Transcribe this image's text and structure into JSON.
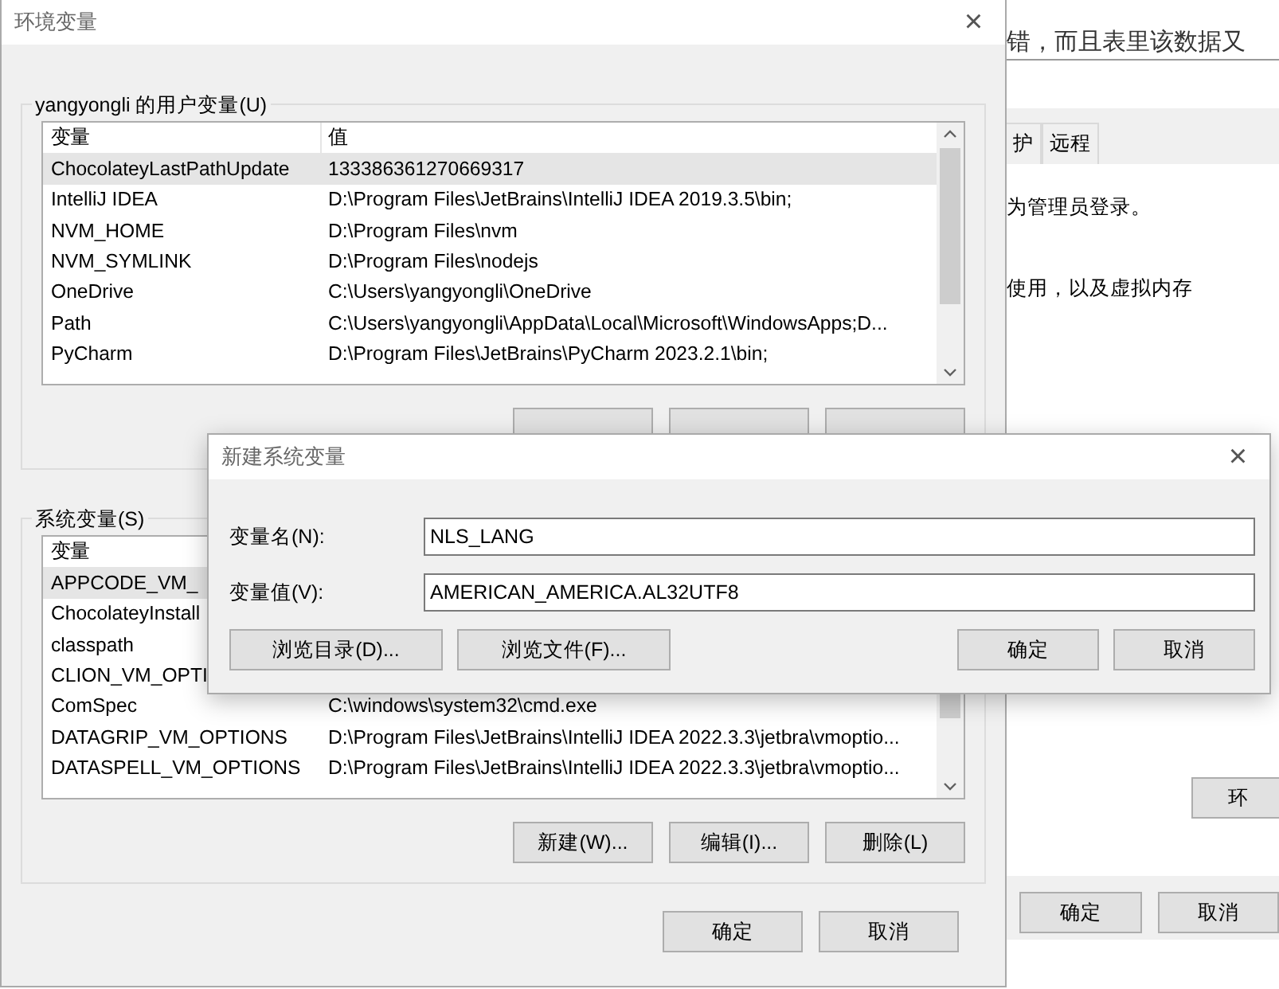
{
  "background_page": {
    "text": "错，而且表里该数据又"
  },
  "system_properties": {
    "tabs": [
      {
        "label": "护",
        "selected": false
      },
      {
        "label": "远程",
        "selected": false
      }
    ],
    "texts": [
      "为管理员登录。",
      "使用，以及虚拟内存"
    ],
    "env_button": "环",
    "buttons": [
      "确定",
      "取消"
    ]
  },
  "env_window": {
    "title": "环境变量",
    "close": "×",
    "user_group": {
      "label": "yangyongli 的用户变量(U)",
      "columns": [
        "变量",
        "值"
      ],
      "rows": [
        {
          "name": "ChocolateyLastPathUpdate",
          "value": "133386361270669317",
          "selected": true
        },
        {
          "name": "IntelliJ IDEA",
          "value": "D:\\Program Files\\JetBrains\\IntelliJ IDEA 2019.3.5\\bin;",
          "selected": false
        },
        {
          "name": "NVM_HOME",
          "value": "D:\\Program Files\\nvm",
          "selected": false
        },
        {
          "name": "NVM_SYMLINK",
          "value": "D:\\Program Files\\nodejs",
          "selected": false
        },
        {
          "name": "OneDrive",
          "value": "C:\\Users\\yangyongli\\OneDrive",
          "selected": false
        },
        {
          "name": "Path",
          "value": "C:\\Users\\yangyongli\\AppData\\Local\\Microsoft\\WindowsApps;D...",
          "selected": false
        },
        {
          "name": "PyCharm",
          "value": "D:\\Program Files\\JetBrains\\PyCharm 2023.2.1\\bin;",
          "selected": false
        }
      ],
      "buttons": [
        {
          "kind": "button"
        },
        {
          "kind": "button"
        },
        {
          "kind": "button"
        }
      ]
    },
    "system_group": {
      "label": "系统变量(S)",
      "columns": [
        "变量"
      ],
      "rows": [
        {
          "name": "APPCODE_VM_",
          "selected": true
        },
        {
          "name": "ChocolateyInstall",
          "selected": false
        },
        {
          "name": "classpath",
          "selected": false
        },
        {
          "name": "CLION_VM_OPTI",
          "selected": false
        },
        {
          "name": "ComSpec",
          "value": "C:\\windows\\system32\\cmd.exe",
          "selected": false
        },
        {
          "name": "DATAGRIP_VM_OPTIONS",
          "value": "D:\\Program Files\\JetBrains\\IntelliJ IDEA 2022.3.3\\jetbra\\vmoptio...",
          "selected": false
        },
        {
          "name": "DATASPELL_VM_OPTIONS",
          "value": "D:\\Program Files\\JetBrains\\IntelliJ IDEA 2022.3.3\\jetbra\\vmoptio...",
          "selected": false
        }
      ],
      "buttons": [
        "新建(W)...",
        "编辑(I)...",
        "删除(L)"
      ]
    },
    "buttons": [
      "确定",
      "取消"
    ]
  },
  "dialog": {
    "title": "新建系统变量",
    "close": "×",
    "fields": [
      {
        "label": "变量名(N):",
        "value": "NLS_LANG"
      },
      {
        "label": "变量值(V):",
        "value": "AMERICAN_AMERICA.AL32UTF8"
      }
    ],
    "buttons": [
      {
        "label": "浏览目录(D)...",
        "kind": "left"
      },
      {
        "label": "浏览文件(F)...",
        "kind": "left"
      },
      {
        "label": "确定",
        "kind": "right"
      },
      {
        "label": "取消",
        "kind": "right"
      }
    ]
  }
}
